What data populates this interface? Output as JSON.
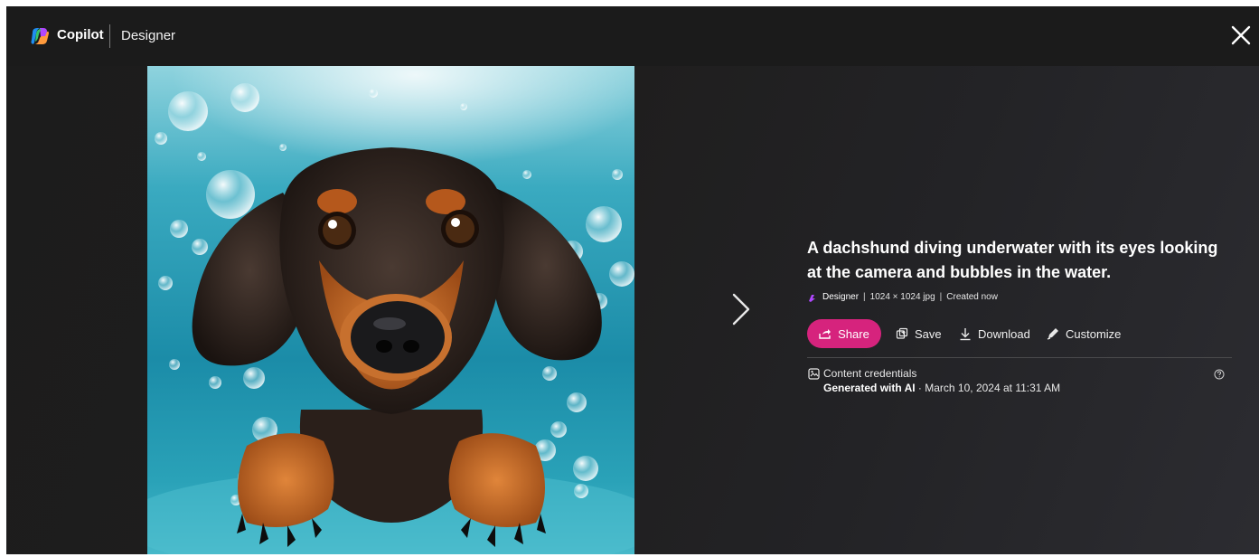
{
  "header": {
    "brand": "Copilot",
    "product": "Designer",
    "logo_icon": "copilot-logo",
    "close_icon": "close-icon"
  },
  "image": {
    "alt": "A dachshund diving underwater with its eyes looking at the camera and bubbles in the water."
  },
  "details": {
    "title": "A dachshund diving underwater with its eyes looking at the camera and bubbles in the water.",
    "meta": {
      "source": "Designer",
      "dimensions": "1024 × 1024 jpg",
      "created": "Created now",
      "separator": "|"
    },
    "actions": {
      "share": "Share",
      "save": "Save",
      "download": "Download",
      "customize": "Customize"
    },
    "credentials": {
      "label": "Content credentials",
      "generated": "Generated with AI",
      "date": "· March 10, 2024 at 11:31 AM"
    }
  },
  "colors": {
    "accent": "#d6237d",
    "background": "#1e1e1e",
    "text": "#ffffff"
  }
}
